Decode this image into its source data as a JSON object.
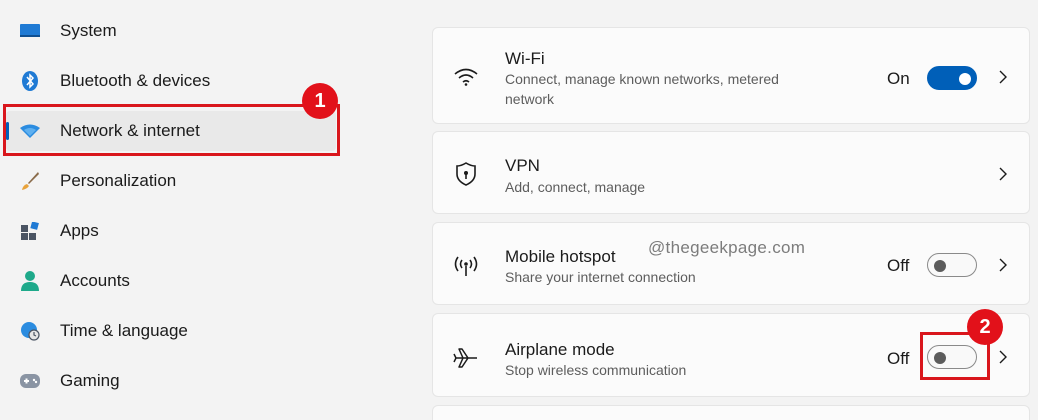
{
  "sidebar": {
    "items": [
      {
        "label": "System",
        "icon": "monitor-icon",
        "selected": false
      },
      {
        "label": "Bluetooth & devices",
        "icon": "bluetooth-icon",
        "selected": false
      },
      {
        "label": "Network & internet",
        "icon": "wifi-diamond-icon",
        "selected": true
      },
      {
        "label": "Personalization",
        "icon": "brush-icon",
        "selected": false
      },
      {
        "label": "Apps",
        "icon": "apps-icon",
        "selected": false
      },
      {
        "label": "Accounts",
        "icon": "person-icon",
        "selected": false
      },
      {
        "label": "Time & language",
        "icon": "globe-clock-icon",
        "selected": false
      },
      {
        "label": "Gaming",
        "icon": "gamepad-icon",
        "selected": false
      }
    ]
  },
  "settings": {
    "wifi": {
      "title": "Wi-Fi",
      "subtitle": "Connect, manage known networks, metered network",
      "state": "On",
      "icon": "wifi-icon"
    },
    "vpn": {
      "title": "VPN",
      "subtitle": "Add, connect, manage",
      "icon": "shield-icon"
    },
    "hotspot": {
      "title": "Mobile hotspot",
      "subtitle": "Share your internet connection",
      "state": "Off",
      "icon": "hotspot-icon"
    },
    "airplane": {
      "title": "Airplane mode",
      "subtitle": "Stop wireless communication",
      "state": "Off",
      "icon": "airplane-icon"
    }
  },
  "annotations": {
    "step1": "1",
    "step2": "2"
  },
  "watermark": "@thegeekpage.com",
  "colors": {
    "accent": "#005fb8",
    "annotation": "#e2111a",
    "background": "#f3f3f3",
    "card": "#fbfbfb"
  }
}
